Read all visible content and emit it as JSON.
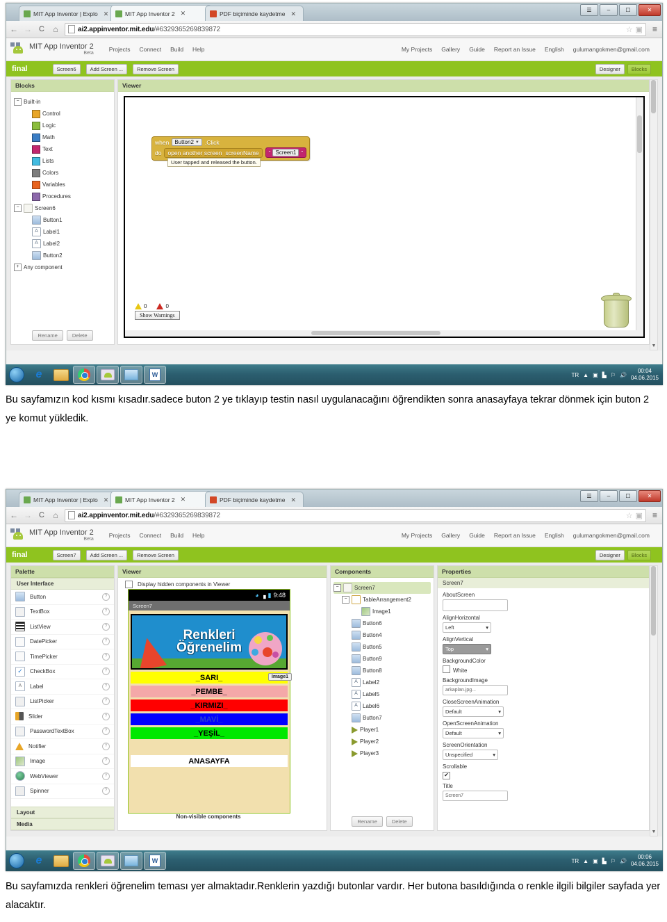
{
  "browser": {
    "tabs": [
      {
        "label": "MIT App Inventor | Explo",
        "active": false,
        "favicon": "#6aa84f"
      },
      {
        "label": "MIT App Inventor 2",
        "active": true,
        "favicon": "#6aa84f"
      },
      {
        "label": "PDF biçiminde kaydetme",
        "active": false,
        "favicon": "#d24726"
      }
    ],
    "window_buttons": [
      "❐",
      "–",
      "❐",
      "✕"
    ],
    "nav": {
      "back": "←",
      "forward": "→",
      "reload": "C",
      "home": "⌂"
    },
    "url_prefix": "ai2.appinventor.mit.edu",
    "url_suffix": "/#6329365269839872",
    "star_icon": "☆",
    "menu_icon": "≡"
  },
  "app": {
    "brand": "MIT App Inventor 2",
    "beta": "Beta",
    "nav": [
      "Projects",
      "Connect",
      "Build",
      "Help"
    ],
    "right_nav": [
      "My Projects",
      "Gallery",
      "Guide",
      "Report an Issue",
      "English",
      "gulumangokmen@gmail.com"
    ],
    "project_name": "final",
    "add_screen": "Add Screen ...",
    "remove_screen": "Remove Screen",
    "designer_label": "Designer",
    "blocks_label": "Blocks"
  },
  "screenshot1": {
    "screen_selector": "Screen6",
    "active_view": "Blocks",
    "blocks_panel": {
      "header": "Blocks",
      "builtin_label": "Built-in",
      "builtin": [
        {
          "label": "Control",
          "color": "#e8a628"
        },
        {
          "label": "Logic",
          "color": "#8bbd3c"
        },
        {
          "label": "Math",
          "color": "#3a7dc4"
        },
        {
          "label": "Text",
          "color": "#c2276e"
        },
        {
          "label": "Lists",
          "color": "#43bbe0"
        },
        {
          "label": "Colors",
          "color": "#7d7d7d"
        },
        {
          "label": "Variables",
          "color": "#e8631e"
        },
        {
          "label": "Procedures",
          "color": "#8c68ab"
        }
      ],
      "screen_node": "Screen6",
      "components": [
        "Button1",
        "Label1",
        "Label2",
        "Button2"
      ],
      "any_component": "Any component",
      "rename": "Rename",
      "delete": "Delete"
    },
    "viewer": {
      "header": "Viewer",
      "block": {
        "when": "when",
        "component": "Button2",
        "event": ".Click",
        "do": "do",
        "action": "open another screen",
        "arg_label": "screenName",
        "string_value": "Screen1",
        "tooltip": "User tapped and released the button."
      },
      "warnings_count": "0",
      "errors_count": "0",
      "show_warnings": "Show Warnings"
    },
    "taskbar": {
      "lang": "TR",
      "time": "00:04",
      "date": "04.06.2015"
    }
  },
  "caption1": "Bu sayfamızın kod kısmı kısadır.sadece buton 2 ye tıklayıp testin nasıl uygulanacağını öğrendikten sonra anasayfaya tekrar dönmek için buton 2 ye komut yükledik.",
  "screenshot2": {
    "screen_selector": "Screen7",
    "active_view": "Designer",
    "palette": {
      "header": "Palette",
      "sections": [
        "User Interface",
        "Layout",
        "Media"
      ],
      "items": [
        "Button",
        "TextBox",
        "ListView",
        "DatePicker",
        "TimePicker",
        "CheckBox",
        "Label",
        "ListPicker",
        "Slider",
        "PasswordTextBox",
        "Notifier",
        "Image",
        "WebViewer",
        "Spinner"
      ],
      "help_icon": "?"
    },
    "viewer": {
      "header": "Viewer",
      "display_hidden": "Display hidden components in Viewer",
      "phone": {
        "status_time": "9:48",
        "title": "Screen7",
        "banner_line1": "Renkleri",
        "banner_line2": "Öğrenelim",
        "image_tag": "Image1",
        "buttons": [
          {
            "label": "_SARI_",
            "bg": "#ffff00",
            "fg": "#000000"
          },
          {
            "label": "_PEMBE_",
            "bg": "#f4a8a8",
            "fg": "#000000"
          },
          {
            "label": "_KIRMIZI_",
            "bg": "#ff0000",
            "fg": "#000000"
          },
          {
            "label": "_MAVİ_",
            "bg": "#0000ff",
            "fg": "#2b3fcf"
          },
          {
            "label": "_YEŞİL_",
            "bg": "#00e800",
            "fg": "#000000"
          },
          {
            "label": "ANASAYFA",
            "bg": "#ffffff",
            "fg": "#000000"
          }
        ]
      },
      "non_visible": "Non-visible components"
    },
    "components": {
      "header": "Components",
      "tree": [
        {
          "label": "Screen7",
          "type": "screen",
          "depth": 0,
          "selected": true
        },
        {
          "label": "TableArrangement2",
          "type": "table",
          "depth": 1
        },
        {
          "label": "Image1",
          "type": "image",
          "depth": 2
        },
        {
          "label": "Button6",
          "type": "button",
          "depth": 1
        },
        {
          "label": "Button4",
          "type": "button",
          "depth": 1
        },
        {
          "label": "Button5",
          "type": "button",
          "depth": 1
        },
        {
          "label": "Button9",
          "type": "button",
          "depth": 1
        },
        {
          "label": "Button8",
          "type": "button",
          "depth": 1
        },
        {
          "label": "Label2",
          "type": "label",
          "depth": 1
        },
        {
          "label": "Label5",
          "type": "label",
          "depth": 1
        },
        {
          "label": "Label6",
          "type": "label",
          "depth": 1
        },
        {
          "label": "Button7",
          "type": "button",
          "depth": 1
        },
        {
          "label": "Player1",
          "type": "player",
          "depth": 1
        },
        {
          "label": "Player2",
          "type": "player",
          "depth": 1
        },
        {
          "label": "Player3",
          "type": "player",
          "depth": 1
        }
      ],
      "rename": "Rename",
      "delete": "Delete"
    },
    "properties": {
      "header": "Properties",
      "selected_component": "Screen7",
      "fields": [
        {
          "name": "AboutScreen",
          "type": "textarea",
          "value": ""
        },
        {
          "name": "AlignHorizontal",
          "type": "select",
          "value": "Left"
        },
        {
          "name": "AlignVertical",
          "type": "select-grey",
          "value": "Top"
        },
        {
          "name": "BackgroundColor",
          "type": "color",
          "value": "White"
        },
        {
          "name": "BackgroundImage",
          "type": "text",
          "value": "arkaplan.jpg..."
        },
        {
          "name": "CloseScreenAnimation",
          "type": "select",
          "value": "Default"
        },
        {
          "name": "OpenScreenAnimation",
          "type": "select",
          "value": "Default"
        },
        {
          "name": "ScreenOrientation",
          "type": "select",
          "value": "Unspecified"
        },
        {
          "name": "Scrollable",
          "type": "checkbox",
          "value": "✔"
        },
        {
          "name": "Title",
          "type": "text",
          "value": "Screen7"
        }
      ]
    },
    "taskbar": {
      "lang": "TR",
      "time": "00:06",
      "date": "04.06.2015"
    }
  },
  "caption2": "Bu sayfamızda renkleri öğrenelim teması yer almaktadır.Renklerin yazdığı butonlar vardır. Her butona basıldığında o renkle ilgili bilgiler sayfada yer alacaktır."
}
